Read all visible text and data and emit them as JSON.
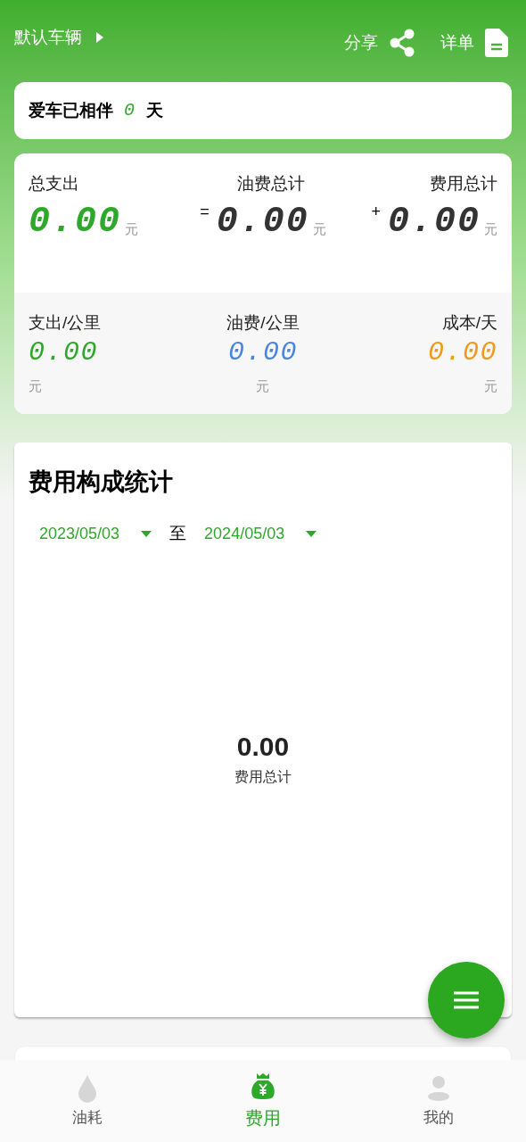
{
  "header": {
    "vehicle": "默认车辆",
    "share": "分享",
    "details": "详单"
  },
  "companion": {
    "label": "爱车已相伴",
    "days": "0",
    "unit": "天"
  },
  "totals": [
    {
      "label": "总支出",
      "value": "0.00",
      "unit": "元",
      "kind": "primary"
    },
    {
      "operator": "=",
      "label": "油费总计",
      "value": "0.00",
      "unit": "元",
      "kind": "plain"
    },
    {
      "operator": "+",
      "label": "费用总计",
      "value": "0.00",
      "unit": "元",
      "kind": "plain"
    }
  ],
  "rates": [
    {
      "label": "支出/公里",
      "value": "0.00",
      "unit": "元",
      "color": "#2ea82a"
    },
    {
      "label": "油费/公里",
      "value": "0.00",
      "unit": "元",
      "color": "#4a86e0"
    },
    {
      "label": "成本/天",
      "value": "0.00",
      "unit": "元",
      "color": "#ef9a1c"
    }
  ],
  "stats": {
    "title": "费用构成统计",
    "start": "2023/05/03",
    "separator": "至",
    "end": "2024/05/03",
    "total": "0.00",
    "total_label": "费用总计"
  },
  "tabs": [
    {
      "label": "油耗",
      "kind": "drop",
      "selected": false
    },
    {
      "label": "费用",
      "kind": "bag",
      "selected": true
    },
    {
      "label": "我的",
      "kind": "person",
      "selected": false
    }
  ]
}
